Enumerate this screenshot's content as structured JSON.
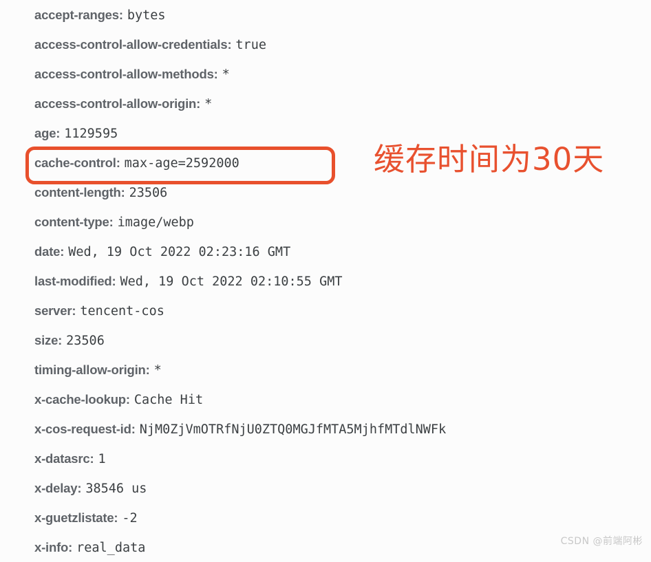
{
  "panel": {
    "name": "response-headers-panel",
    "background_color": "#fcfcfc",
    "name_color": "#5f6368",
    "value_color": "#3c4043"
  },
  "headers": [
    {
      "name": "accept-ranges:",
      "value": "bytes"
    },
    {
      "name": "access-control-allow-credentials:",
      "value": "true"
    },
    {
      "name": "access-control-allow-methods:",
      "value": "*"
    },
    {
      "name": "access-control-allow-origin:",
      "value": "*"
    },
    {
      "name": "age:",
      "value": "1129595"
    },
    {
      "name": "cache-control:",
      "value": "max-age=2592000"
    },
    {
      "name": "content-length:",
      "value": "23506"
    },
    {
      "name": "content-type:",
      "value": "image/webp"
    },
    {
      "name": "date:",
      "value": "Wed, 19 Oct 2022 02:23:16 GMT"
    },
    {
      "name": "last-modified:",
      "value": "Wed, 19 Oct 2022 02:10:55 GMT"
    },
    {
      "name": "server:",
      "value": "tencent-cos"
    },
    {
      "name": "size:",
      "value": "23506"
    },
    {
      "name": "timing-allow-origin:",
      "value": "*"
    },
    {
      "name": "x-cache-lookup:",
      "value": "Cache Hit"
    },
    {
      "name": "x-cos-request-id:",
      "value": "NjM0ZjVmOTRfNjU0ZTQ0MGJfMTA5MjhfMTdlNWFk"
    },
    {
      "name": "x-datasrc:",
      "value": "1"
    },
    {
      "name": "x-delay:",
      "value": "38546 us"
    },
    {
      "name": "x-guetzlistate:",
      "value": "-2"
    },
    {
      "name": "x-info:",
      "value": "real_data"
    }
  ],
  "annotation": {
    "text": "缓存时间为30天",
    "color": "#e8512f",
    "highlight_border_color": "#e8502c",
    "highlighted_header_index": 5
  },
  "watermark": {
    "text": "CSDN @前端阿彬"
  }
}
